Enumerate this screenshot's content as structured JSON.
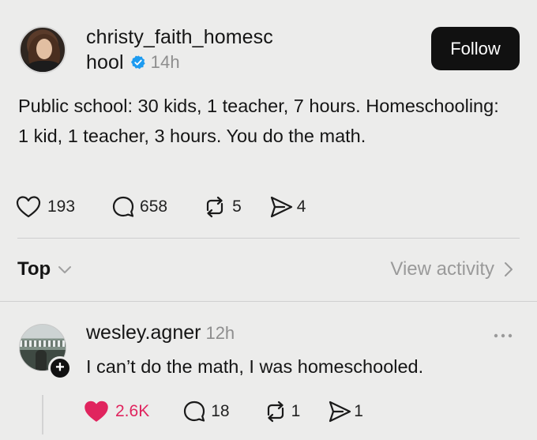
{
  "post": {
    "username_line1": "christy_faith_homesc",
    "username_line2": "hool",
    "time": "14h",
    "follow_label": "Follow",
    "text": "Public school: 30 kids, 1 teacher, 7 hours. Homeschooling: 1 kid, 1 teacher, 3 hours. You do the math.",
    "likes": "193",
    "comments": "658",
    "reposts": "5",
    "shares": "4",
    "verified": true
  },
  "filter": {
    "sort_label": "Top",
    "view_activity_label": "View activity"
  },
  "reply": {
    "username": "wesley.agner",
    "time": "12h",
    "text": "I can’t do the math, I was homeschooled.",
    "likes": "2.6K",
    "comments": "18",
    "reposts": "1",
    "shares": "1",
    "liked": true
  },
  "colors": {
    "background": "#ececeb",
    "text": "#151515",
    "muted": "#8e8e8e",
    "verified_blue": "#1d9bf0",
    "like_red": "#e0245e",
    "button_bg": "#111111"
  },
  "icons": {
    "heart": "heart-icon",
    "comment": "comment-bubble-icon",
    "repost": "repost-icon",
    "share": "send-icon",
    "verified": "verified-badge-icon",
    "chevron_down": "chevron-down-icon",
    "chevron_right": "chevron-right-icon",
    "more": "more-dots-icon",
    "plus": "plus-icon"
  }
}
